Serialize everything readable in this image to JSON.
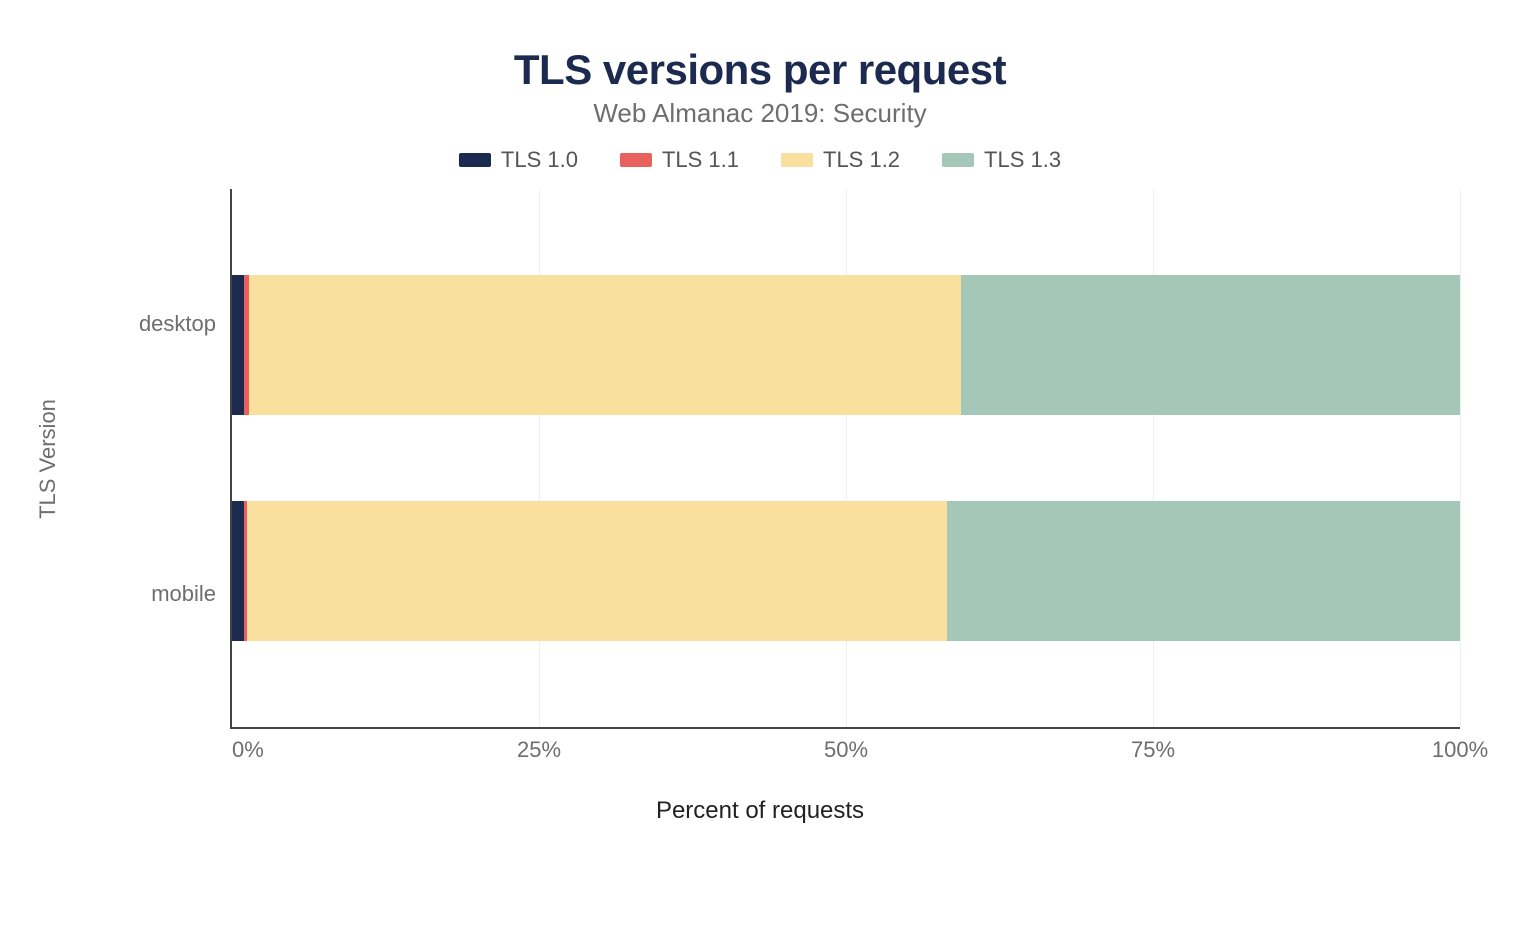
{
  "title": "TLS versions per request",
  "subtitle": "Web Almanac 2019: Security",
  "legend": [
    {
      "label": "TLS 1.0",
      "color": "#1b2a4e"
    },
    {
      "label": "TLS 1.1",
      "color": "#e8615e"
    },
    {
      "label": "TLS 1.2",
      "color": "#f9e09e"
    },
    {
      "label": "TLS 1.3",
      "color": "#a5c7b8"
    }
  ],
  "ylabel": "TLS Version",
  "xlabel": "Percent of requests",
  "categories": [
    "desktop",
    "mobile"
  ],
  "ticks": [
    "0%",
    "25%",
    "50%",
    "75%",
    "100%"
  ],
  "chart_data": {
    "type": "bar",
    "orientation": "horizontal-stacked",
    "title": "TLS versions per request",
    "subtitle": "Web Almanac 2019: Security",
    "xlabel": "Percent of requests",
    "ylabel": "TLS Version",
    "xlim": [
      0,
      100
    ],
    "categories": [
      "desktop",
      "mobile"
    ],
    "series": [
      {
        "name": "TLS 1.0",
        "color": "#1b2a4e",
        "values": [
          1.0,
          1.0
        ]
      },
      {
        "name": "TLS 1.1",
        "color": "#e8615e",
        "values": [
          0.4,
          0.2
        ]
      },
      {
        "name": "TLS 1.2",
        "color": "#f9e09e",
        "values": [
          58.0,
          57.0
        ]
      },
      {
        "name": "TLS 1.3",
        "color": "#a5c7b8",
        "values": [
          40.6,
          41.8
        ]
      }
    ],
    "grid": {
      "x": true,
      "y": false
    },
    "legend_position": "top"
  }
}
